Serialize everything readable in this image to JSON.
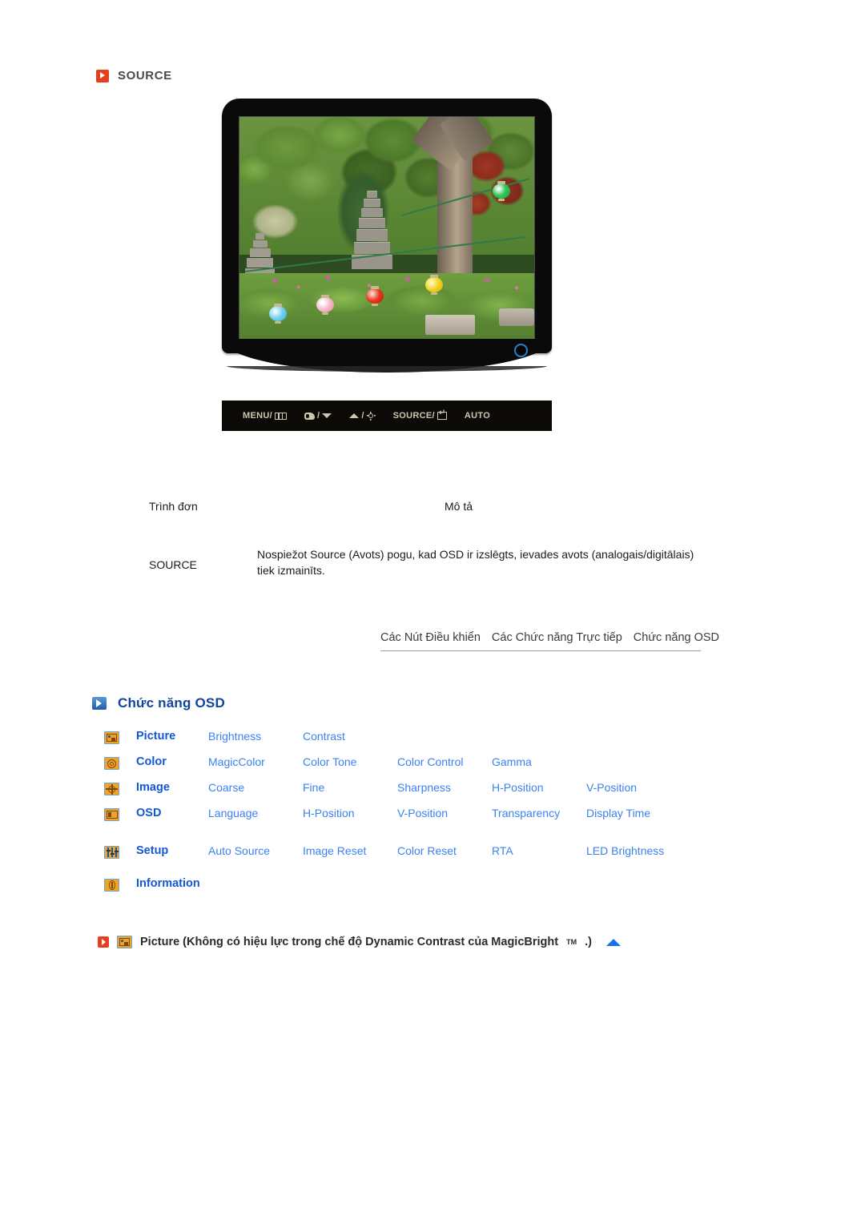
{
  "section": {
    "marker_icon": "red-play-marker-icon",
    "title": "SOURCE"
  },
  "monitor": {
    "power_led_name": "power-led-indicator",
    "buttons": [
      {
        "label": "MENU/",
        "icon": "menu-grid-icon"
      },
      {
        "label": "",
        "icon": "magicbright-icon",
        "sep": "/",
        "icon2": "down-arrow-icon"
      },
      {
        "label": "",
        "icon": "up-arrow-icon",
        "sep": "/",
        "icon2": "brightness-sun-icon"
      },
      {
        "label": "SOURCE/",
        "icon": "enter-key-icon"
      },
      {
        "label": "AUTO",
        "icon": ""
      }
    ],
    "button_labels": {
      "menu": "MENU/",
      "source": "SOURCE/",
      "auto": "AUTO",
      "slash": "/"
    }
  },
  "description_table": {
    "headers": {
      "menu": "Trình đơn",
      "description": "Mô tả"
    },
    "rows": [
      {
        "menu": "SOURCE",
        "description": "Nospiežot Source (Avots) pogu, kad OSD ir izslēgts, ievades avots (analogais/digitālais) tiek izmainīts."
      }
    ]
  },
  "nav_strip": {
    "items": [
      "Các Nút Điều khiển",
      "Các Chức năng Trực tiếp",
      "Chức năng OSD"
    ]
  },
  "osd_section": {
    "marker_icon": "blue-play-marker-icon",
    "title": "Chức năng OSD",
    "rows": [
      {
        "icon": "picture-icon",
        "category": "Picture",
        "items": [
          "Brightness",
          "Contrast"
        ]
      },
      {
        "icon": "color-icon",
        "category": "Color",
        "items": [
          "MagicColor",
          "Color Tone",
          "Color Control",
          "Gamma"
        ]
      },
      {
        "icon": "image-icon",
        "category": "Image",
        "items": [
          "Coarse",
          "Fine",
          "Sharpness",
          "H-Position",
          "V-Position"
        ]
      },
      {
        "icon": "osd-icon",
        "category": "OSD",
        "items": [
          "Language",
          "H-Position",
          "V-Position",
          "Transparency",
          "Display Time"
        ]
      },
      {
        "icon": "setup-icon",
        "category": "Setup",
        "items": [
          "Auto Source",
          "Image Reset",
          "Color Reset",
          "RTA",
          "LED Brightness"
        ]
      },
      {
        "icon": "information-icon",
        "category": "Information",
        "items": []
      }
    ]
  },
  "bottom_note": {
    "marker_icon": "red-play-marker-icon",
    "menu_icon": "picture-icon",
    "text_before": "Picture (Không có hiệu lực trong chế độ Dynamic Contrast của MagicBright",
    "superscript": "TM",
    "text_after": ".)",
    "scroll_icon": "blue-up-triangle-icon"
  },
  "colors": {
    "accent_red": "#e4401f",
    "accent_blue": "#12449b",
    "link_blue": "#3b82f0",
    "category_blue": "#1257d6",
    "icon_amber": "#f0a32a"
  }
}
